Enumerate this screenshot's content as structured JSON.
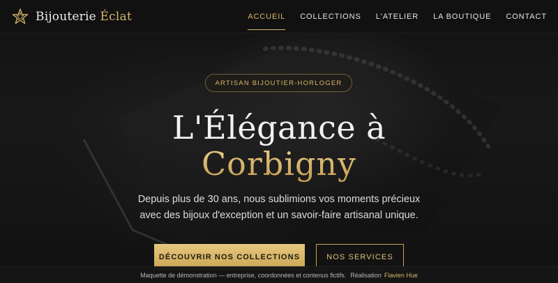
{
  "brand": {
    "name": "Bijouterie",
    "accent": "Éclat",
    "logo_icon": "star-icon"
  },
  "nav": {
    "items": [
      {
        "label": "ACCUEIL",
        "active": true
      },
      {
        "label": "COLLECTIONS",
        "active": false
      },
      {
        "label": "L'ATELIER",
        "active": false
      },
      {
        "label": "LA BOUTIQUE",
        "active": false
      },
      {
        "label": "CONTACT",
        "active": false
      }
    ]
  },
  "hero": {
    "badge": "ARTISAN BIJOUTIER-HORLOGER",
    "title_line1": "L'Élégance à",
    "title_line2": "Corbigny",
    "subtitle_line1": "Depuis plus de 30 ans, nous sublimions vos moments précieux",
    "subtitle_line2": "avec des bijoux d'exception et un savoir-faire artisanal unique.",
    "primary_button": "DÉCOUVRIR NOS COLLECTIONS",
    "secondary_button": "NOS SERVICES"
  },
  "footer": {
    "notice": "Maquette de démonstration — entreprise, coordonnées et contenus fictifs.",
    "credit_label": "Réalisation",
    "credit_name": "Flavien Hue"
  },
  "colors": {
    "gold": "#d8b66a",
    "background": "#141414"
  }
}
